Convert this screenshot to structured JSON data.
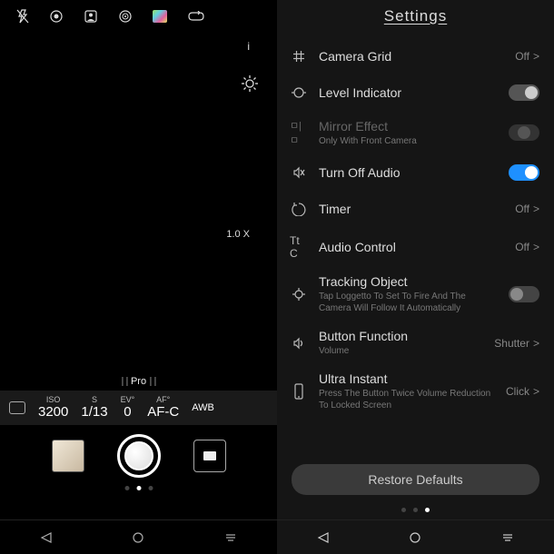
{
  "camera": {
    "info_symbol": "i",
    "zoom": "1.0 X",
    "mode_label": "Pro",
    "exposure": {
      "iso_label": "ISO",
      "iso": "3200",
      "shutter_label": "S",
      "shutter": "1/13",
      "ev_label": "EV°",
      "ev": "0",
      "af_label": "AF°",
      "af": "AF-C",
      "awb": "AWB"
    }
  },
  "settings": {
    "title": "Settings",
    "items": [
      {
        "icon": "grid",
        "title": "Camera Grid",
        "ctrl_type": "offlink",
        "ctrl_text": "Off"
      },
      {
        "icon": "level",
        "title": "Level Indicator",
        "ctrl_type": "toggle",
        "state": "on-gray"
      },
      {
        "icon": "mirror",
        "title": "Mirror Effect",
        "sub": "Only With Front Camera",
        "ctrl_type": "toggle",
        "state": "dim",
        "dim": true
      },
      {
        "icon": "mute",
        "title": "Turn Off Audio",
        "ctrl_type": "toggle",
        "state": "on"
      },
      {
        "icon": "timer",
        "title": "Timer",
        "ctrl_type": "offlink",
        "ctrl_text": "Off"
      },
      {
        "icon": "tt",
        "title": "Audio Control",
        "ctrl_type": "offlink",
        "ctrl_text": "Off"
      },
      {
        "icon": "track",
        "title": "Tracking Object",
        "sub": "Tap Loggetto To Set To Fire And The Camera Will Follow It Automatically",
        "ctrl_type": "toggle",
        "state": "off"
      },
      {
        "icon": "volume",
        "title": "Button Function",
        "sub": "Volume",
        "ctrl_type": "link",
        "ctrl_text": "Shutter"
      },
      {
        "icon": "phone",
        "title": "Ultra Instant",
        "sub": "Press The Button Twice Volume Reduction To Locked Screen",
        "ctrl_type": "link",
        "ctrl_text": "Click"
      }
    ],
    "restore": "Restore Defaults"
  }
}
